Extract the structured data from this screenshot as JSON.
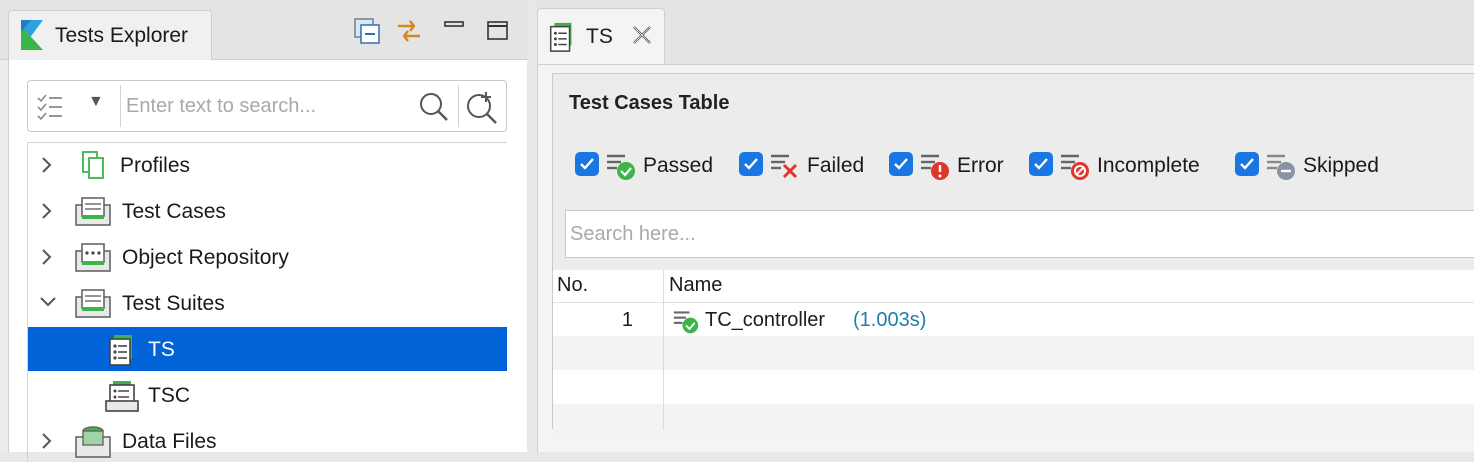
{
  "left_panel": {
    "title": "Tests Explorer",
    "toolbar_icons": [
      "collapse-all-icon",
      "link-with-editor-icon",
      "minimize-icon",
      "maximize-icon"
    ],
    "search": {
      "placeholder": "Enter text to search...",
      "value": ""
    },
    "tree": [
      {
        "label": "Profiles",
        "expanded": false,
        "icon": "profiles-icon"
      },
      {
        "label": "Test Cases",
        "expanded": false,
        "icon": "test-cases-folder-icon"
      },
      {
        "label": "Object Repository",
        "expanded": false,
        "icon": "object-repository-folder-icon"
      },
      {
        "label": "Test Suites",
        "expanded": true,
        "icon": "test-suites-folder-icon"
      },
      {
        "label": "TS",
        "selected": true,
        "icon": "test-suite-icon"
      },
      {
        "label": "TSC",
        "icon": "test-suite-collection-icon"
      },
      {
        "label": "Data Files",
        "expanded": false,
        "icon": "data-files-folder-icon"
      }
    ]
  },
  "editor": {
    "tab_label": "TS",
    "section_title": "Test Cases Table",
    "filters": [
      {
        "label": "Passed",
        "checked": true,
        "status_color": "#3bb54a"
      },
      {
        "label": "Failed",
        "checked": true,
        "status_color": "#e0352b"
      },
      {
        "label": "Error",
        "checked": true,
        "status_color": "#e0352b"
      },
      {
        "label": "Incomplete",
        "checked": true,
        "status_color": "#e0352b"
      },
      {
        "label": "Skipped",
        "checked": true,
        "status_color": "#8a93a6"
      }
    ],
    "search_placeholder": "Search here...",
    "table": {
      "columns": [
        "No.",
        "Name"
      ],
      "rows": [
        {
          "no": "1",
          "name": "TC_controller",
          "duration": "(1.003s)",
          "status": "passed"
        }
      ]
    }
  },
  "colors": {
    "selection": "#0063d8",
    "checkbox": "#1a76e3",
    "duration_text": "#1f80a8"
  }
}
